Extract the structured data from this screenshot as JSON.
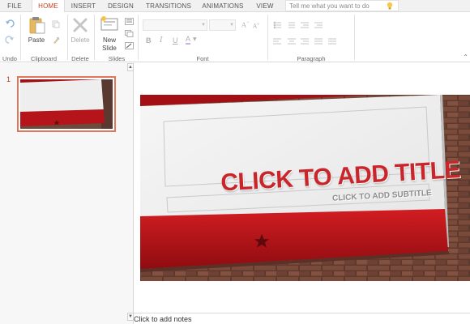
{
  "tabs": [
    {
      "label": "FILE"
    },
    {
      "label": "HOME",
      "active": true
    },
    {
      "label": "INSERT"
    },
    {
      "label": "DESIGN"
    },
    {
      "label": "TRANSITIONS"
    },
    {
      "label": "ANIMATIONS"
    },
    {
      "label": "VIEW"
    }
  ],
  "tell_me": {
    "placeholder": "Tell me what you want to do",
    "icon": "lightbulb-icon"
  },
  "ribbon": {
    "undo": {
      "group_label": "Undo",
      "undo_icon": "undo-icon",
      "redo_icon": "redo-icon"
    },
    "clipboard": {
      "group_label": "Clipboard",
      "paste_label": "Paste",
      "copy_icon": "copy-icon",
      "format_painter_icon": "format-painter-icon"
    },
    "delete": {
      "group_label": "Delete",
      "delete_label": "Delete"
    },
    "slides": {
      "group_label": "Slides",
      "new_slide_label_1": "New",
      "new_slide_label_2": "Slide",
      "layout_icon": "layout-icon",
      "duplicate_icon": "duplicate-icon",
      "reset_icon": "reset-icon"
    },
    "font": {
      "group_label": "Font",
      "font_name": "",
      "font_size": "",
      "bold": "B",
      "italic": "I",
      "underline": "U",
      "font_color": "A"
    },
    "paragraph": {
      "group_label": "Paragraph"
    }
  },
  "thumbnails": [
    {
      "number": "1",
      "selected": true
    }
  ],
  "slide": {
    "title": "CLICK TO ADD TITLE",
    "subtitle": "CLICK TO ADD SUBTITLE"
  },
  "notes": {
    "placeholder": "Click to add notes"
  },
  "colors": {
    "accent": "#c43e1c",
    "thumb_border": "#e0775a",
    "slide_red": "#b5141a",
    "title_red": "#c9262b",
    "subtitle_gray": "#8d8d8d"
  }
}
